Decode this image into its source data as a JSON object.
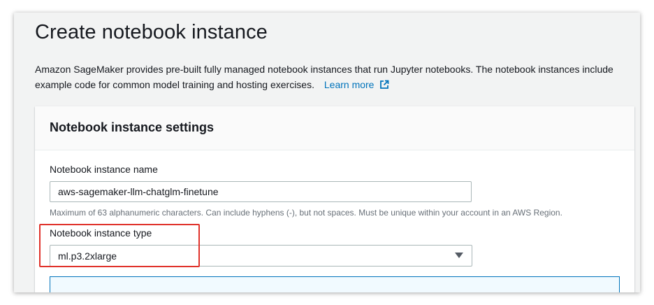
{
  "page": {
    "title": "Create notebook instance",
    "intro_text": "Amazon SageMaker provides pre-built fully managed notebook instances that run Jupyter notebooks. The notebook instances include example code for common model training and hosting exercises.",
    "learn_more": "Learn more",
    "link_color": "#0073bb"
  },
  "settings": {
    "title": "Notebook instance settings",
    "name_field": {
      "label": "Notebook instance name",
      "value": "aws-sagemaker-llm-chatglm-finetune",
      "help": "Maximum of 63 alphanumeric characters. Can include hyphens (-), but not spaces. Must be unique within your account in an AWS Region."
    },
    "type_field": {
      "label": "Notebook instance type",
      "selected": "ml.p3.2xlarge"
    }
  },
  "icons": {
    "external_link": "external-link-icon",
    "dropdown": "caret-down-icon"
  },
  "highlight_color": "#e0322b"
}
